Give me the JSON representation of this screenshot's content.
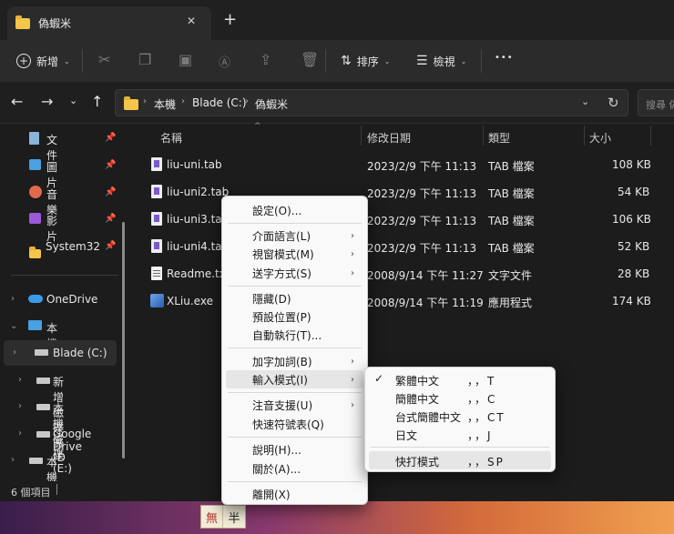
{
  "window": {
    "tab_title": "偽蝦米",
    "new_tab_label": "+",
    "close_tab_label": "✕"
  },
  "toolbar": {
    "new_label": "新增",
    "sort_label": "排序",
    "view_label": "檢視",
    "more_label": "•••"
  },
  "address": {
    "segments": [
      "本機",
      "Blade (C:)",
      "偽蝦米"
    ],
    "search_placeholder": "搜尋 偽"
  },
  "sidebar": {
    "quick": [
      {
        "label": "文件",
        "icon": "document-icon"
      },
      {
        "label": "圖片",
        "icon": "pictures-icon"
      },
      {
        "label": "音樂",
        "icon": "music-icon"
      },
      {
        "label": "影片",
        "icon": "videos-icon"
      },
      {
        "label": "System32",
        "icon": "folder-icon"
      }
    ],
    "onedrive": "OneDrive",
    "thispc": "本機",
    "drives": [
      "Blade (C:)",
      "新增磁碟區 (D",
      "本機磁碟 (E:)",
      "Google Drive",
      "本機磁碟 (E:)"
    ]
  },
  "columns": {
    "name": "名稱",
    "modified": "修改日期",
    "type": "類型",
    "size": "大小"
  },
  "files": [
    {
      "name": "liu-uni.tab",
      "date": "2023/2/9 下午 11:13",
      "type": "TAB 檔案",
      "size": "108 KB"
    },
    {
      "name": "liu-uni2.tab",
      "date": "2023/2/9 下午 11:13",
      "type": "TAB 檔案",
      "size": "54 KB"
    },
    {
      "name": "liu-uni3.tab",
      "date": "2023/2/9 下午 11:13",
      "type": "TAB 檔案",
      "size": "106 KB"
    },
    {
      "name": "liu-uni4.tab",
      "date": "2023/2/9 下午 11:13",
      "type": "TAB 檔案",
      "size": "52 KB"
    },
    {
      "name": "Readme.txt",
      "date": "2008/9/14 下午 11:27",
      "type": "文字文件",
      "size": "28 KB"
    },
    {
      "name": "XLiu.exe",
      "date": "2008/9/14 下午 11:19",
      "type": "應用程式",
      "size": "174 KB"
    }
  ],
  "status": {
    "count": "6 個項目"
  },
  "menu": {
    "settings": "設定(O)...",
    "ui_lang": "介面語言(L)",
    "window_mode": "視窗模式(M)",
    "send_mode": "送字方式(S)",
    "hide": "隱藏(D)",
    "default_pos": "預設位置(P)",
    "autorun": "自動執行(T)...",
    "encrypt": "加字加詞(B)",
    "input_mode": "輸入模式(I)",
    "phonetic": "注音支援(U)",
    "quick_symbols": "快速符號表(Q)",
    "help": "說明(H)...",
    "about": "關於(A)...",
    "exit": "離開(X)"
  },
  "submenu": {
    "items": [
      {
        "label": "繁體中文",
        "shortcut": "，，T",
        "checked": true
      },
      {
        "label": "簡體中文",
        "shortcut": "，，C",
        "checked": false
      },
      {
        "label": "台式簡體中文",
        "shortcut": "，，CT",
        "checked": false
      },
      {
        "label": "日文",
        "shortcut": "，，J",
        "checked": false
      }
    ],
    "quick_type": {
      "label": "快打模式",
      "shortcut": "，，SP"
    },
    "check_mark": "✓"
  },
  "ime": {
    "left": "無",
    "right": "半"
  }
}
